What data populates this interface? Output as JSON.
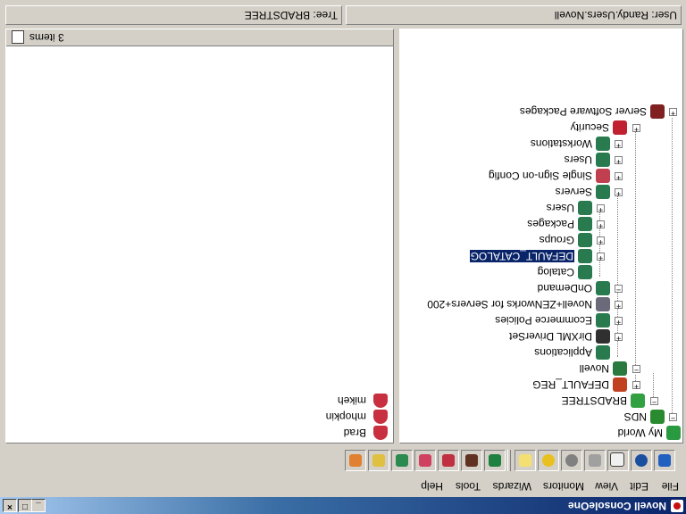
{
  "window": {
    "title": "Novell ConsoleOne"
  },
  "menu": [
    "File",
    "Edit",
    "View",
    "Monitors",
    "Wizards",
    "Tools",
    "Help"
  ],
  "toolbar": {
    "buttons": [
      "exit-icon",
      "find-icon",
      "properties-icon",
      "disabled-icon",
      "stop-icon",
      "refresh-icon",
      "notes-icon",
      "new-user-icon",
      "new-group-icon",
      "new-object-icon",
      "user-template-icon",
      "tree-structure-icon",
      "package-icon",
      "mail-icon"
    ]
  },
  "tree": {
    "nodes": [
      {
        "label": "My World",
        "icon": "globe-icon"
      },
      {
        "label": "NDS",
        "icon": "nds-tree-icon"
      },
      {
        "label": "BRADSTREE",
        "icon": "tree-icon"
      },
      {
        "label": "DEFAULT_REG",
        "icon": "registry-icon"
      },
      {
        "label": "Novell",
        "icon": "organization-icon"
      },
      {
        "label": "Applications",
        "icon": "container-icon"
      },
      {
        "label": "DirXML DriverSet",
        "icon": "driverset-icon"
      },
      {
        "label": "Ecommerce Policies",
        "icon": "container-icon"
      },
      {
        "label": "Novell+ZENworks for Servers+200",
        "icon": "zen-icon"
      },
      {
        "label": "OnDemand",
        "icon": "container-icon"
      },
      {
        "label": "Catalog",
        "icon": "container-icon"
      },
      {
        "label": "DEFAULT_CATALOG",
        "icon": "container-icon"
      },
      {
        "label": "Groups",
        "icon": "container-icon"
      },
      {
        "label": "Packages",
        "icon": "container-icon"
      },
      {
        "label": "Users",
        "icon": "container-icon"
      },
      {
        "label": "Servers",
        "icon": "container-icon"
      },
      {
        "label": "Single Sign-on Config",
        "icon": "sso-icon"
      },
      {
        "label": "Users",
        "icon": "container-icon"
      },
      {
        "label": "Workstations",
        "icon": "container-icon"
      },
      {
        "label": "Security",
        "icon": "security-icon"
      },
      {
        "label": "Server Software Packages",
        "icon": "server-package-icon"
      }
    ],
    "selected": "DEFAULT_CATALOG"
  },
  "list": {
    "items": [
      {
        "label": "Brad",
        "icon": "user-icon"
      },
      {
        "label": "mhopkin",
        "icon": "user-icon"
      },
      {
        "label": "mikeh",
        "icon": "user-icon"
      }
    ],
    "count_text": "3 items"
  },
  "status": {
    "user": "User: Randy.Users.Novell",
    "tree": "Tree: BRADSTREE"
  }
}
